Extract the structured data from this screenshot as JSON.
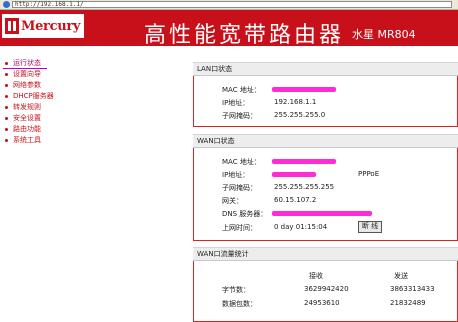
{
  "address_bar": {
    "url": "http://192.168.1.1/"
  },
  "banner": {
    "brand": "Mercury",
    "title": "高性能宽带路由器",
    "model": "水星 MR804"
  },
  "sidebar": {
    "items": [
      {
        "label": "运行状态"
      },
      {
        "label": "设置向导"
      },
      {
        "label": "网络参数"
      },
      {
        "label": "DHCP服务器"
      },
      {
        "label": "转发规则"
      },
      {
        "label": "安全设置"
      },
      {
        "label": "路由功能"
      },
      {
        "label": "系统工具"
      }
    ]
  },
  "lan": {
    "title": "LAN口状态",
    "mac_label": "MAC 地址：",
    "ip_label": "IP地址：",
    "ip": "192.168.1.1",
    "mask_label": "子网掩码：",
    "mask": "255.255.255.0"
  },
  "wan": {
    "title": "WAN口状态",
    "mac_label": "MAC 地址：",
    "ip_label": "IP地址：",
    "conn_type": "PPPoE",
    "mask_label": "子网掩码：",
    "mask": "255.255.255.255",
    "gateway_label": "网关：",
    "gateway": "60.15.107.2",
    "dns_label": "DNS 服务器：",
    "uptime_label": "上网时间：",
    "uptime": "0 day 01:15:04",
    "disconnect_label": "断 线"
  },
  "traffic": {
    "title": "WAN口流量统计",
    "col_recv": "接收",
    "col_send": "发送",
    "bytes_label": "字节数：",
    "bytes_recv": "3629942420",
    "bytes_send": "3863313433",
    "packets_label": "数据包数：",
    "packets_recv": "24953610",
    "packets_send": "21832489"
  },
  "colors": {
    "brand_red": "#c8101b",
    "redaction": "#ff2bd6"
  }
}
